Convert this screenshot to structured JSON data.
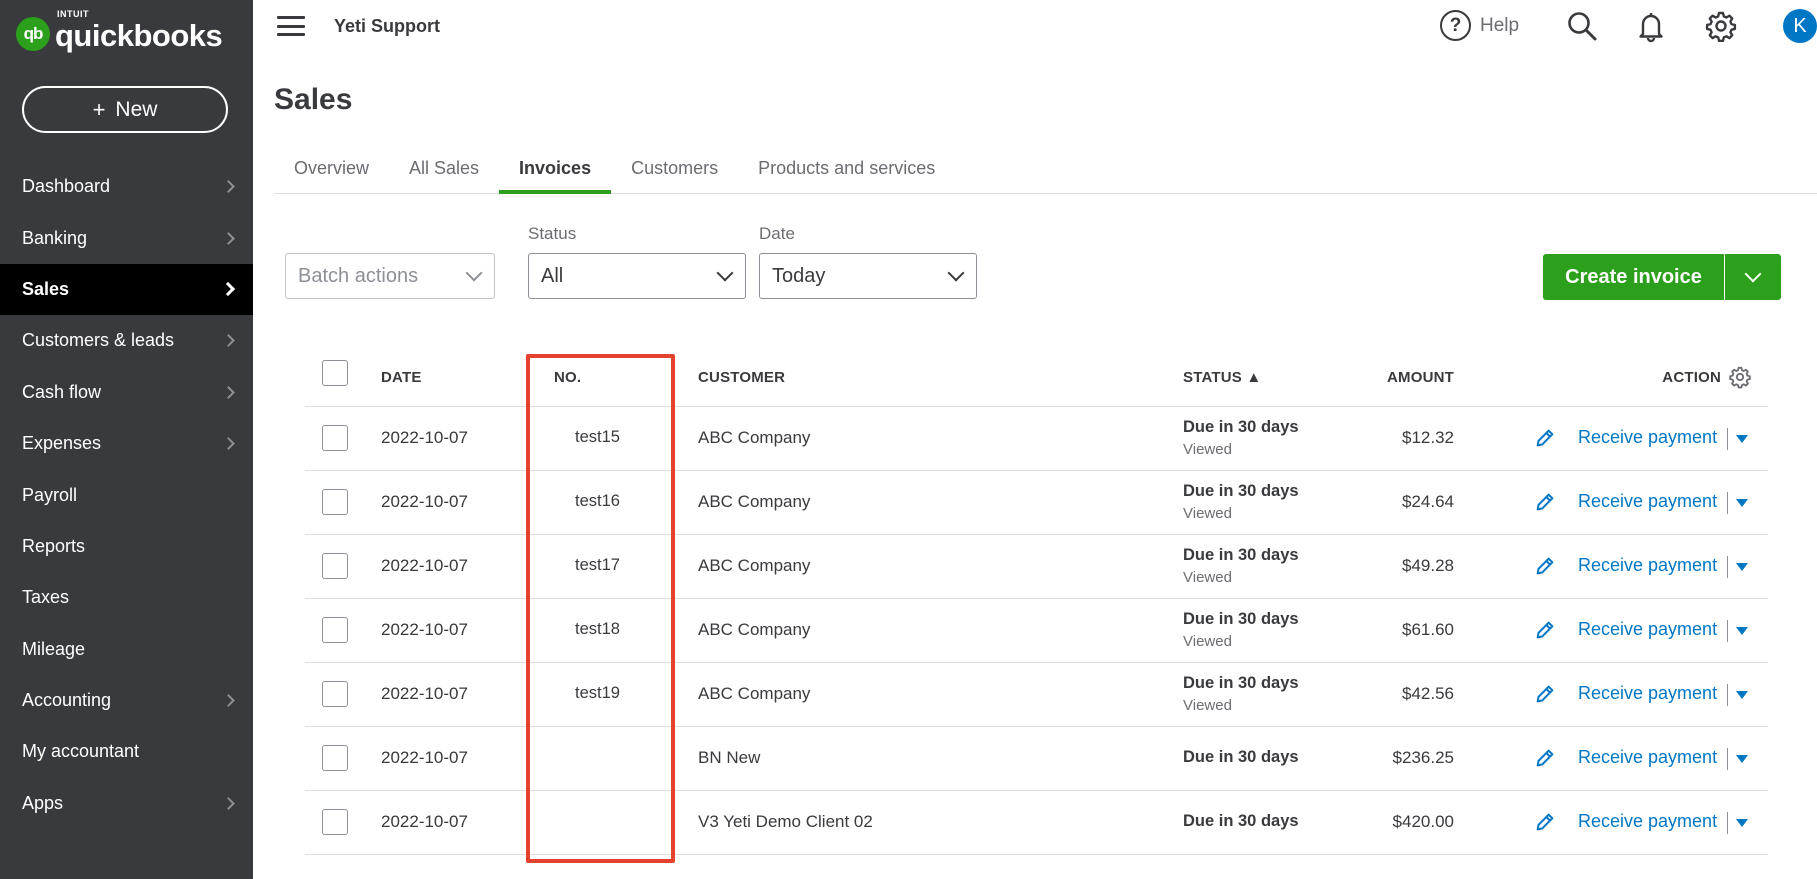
{
  "brand": {
    "mark": "qb",
    "intuit": "INTUIT",
    "wordmark": "quickbooks",
    "color": "#2ca01c"
  },
  "sidebar": {
    "new_label": "New",
    "items": [
      {
        "label": "Dashboard",
        "chevron": true,
        "active": false
      },
      {
        "label": "Banking",
        "chevron": true,
        "active": false
      },
      {
        "label": "Sales",
        "chevron": true,
        "active": true
      },
      {
        "label": "Customers & leads",
        "chevron": true,
        "active": false
      },
      {
        "label": "Cash flow",
        "chevron": true,
        "active": false
      },
      {
        "label": "Expenses",
        "chevron": true,
        "active": false
      },
      {
        "label": "Payroll",
        "chevron": false,
        "active": false
      },
      {
        "label": "Reports",
        "chevron": false,
        "active": false
      },
      {
        "label": "Taxes",
        "chevron": false,
        "active": false
      },
      {
        "label": "Mileage",
        "chevron": false,
        "active": false
      },
      {
        "label": "Accounting",
        "chevron": true,
        "active": false
      },
      {
        "label": "My accountant",
        "chevron": false,
        "active": false
      },
      {
        "label": "Apps",
        "chevron": true,
        "active": false
      }
    ]
  },
  "topbar": {
    "company": "Yeti Support",
    "help_label": "Help",
    "help_glyph": "?",
    "avatar_initial": "K",
    "icons": [
      "menu-icon",
      "help-icon",
      "search-icon",
      "bell-icon",
      "gear-icon"
    ]
  },
  "page": {
    "title": "Sales",
    "tabs": [
      "Overview",
      "All Sales",
      "Invoices",
      "Customers",
      "Products and services"
    ],
    "active_tab": "Invoices"
  },
  "filters": {
    "batch_actions": "Batch actions",
    "status_label": "Status",
    "status_value": "All",
    "date_label": "Date",
    "date_value": "Today"
  },
  "create_invoice_label": "Create invoice",
  "table": {
    "headers": {
      "date": "DATE",
      "no": "NO.",
      "customer": "CUSTOMER",
      "amount": "AMOUNT",
      "status": "STATUS ▲",
      "action": "ACTION"
    },
    "action_label": "Receive payment",
    "rows": [
      {
        "date": "2022-10-07",
        "no": "test15",
        "customer": "ABC Company",
        "amount": "$12.32",
        "status": "Due in 30 days",
        "sub": "Viewed"
      },
      {
        "date": "2022-10-07",
        "no": "test16",
        "customer": "ABC Company",
        "amount": "$24.64",
        "status": "Due in 30 days",
        "sub": "Viewed"
      },
      {
        "date": "2022-10-07",
        "no": "test17",
        "customer": "ABC Company",
        "amount": "$49.28",
        "status": "Due in 30 days",
        "sub": "Viewed"
      },
      {
        "date": "2022-10-07",
        "no": "test18",
        "customer": "ABC Company",
        "amount": "$61.60",
        "status": "Due in 30 days",
        "sub": "Viewed"
      },
      {
        "date": "2022-10-07",
        "no": "test19",
        "customer": "ABC Company",
        "amount": "$42.56",
        "status": "Due in 30 days",
        "sub": "Viewed"
      },
      {
        "date": "2022-10-07",
        "no": "",
        "customer": "BN New",
        "amount": "$236.25",
        "status": "Due in 30 days",
        "sub": ""
      },
      {
        "date": "2022-10-07",
        "no": "",
        "customer": "V3 Yeti Demo Client 02",
        "amount": "$420.00",
        "status": "Due in 30 days",
        "sub": ""
      }
    ]
  },
  "colors": {
    "sidebar_bg": "#393a3d",
    "active_nav_bg": "#000000",
    "accent_green": "#2ca01c",
    "link_blue": "#0077c5",
    "highlight_red": "#e4412f"
  }
}
